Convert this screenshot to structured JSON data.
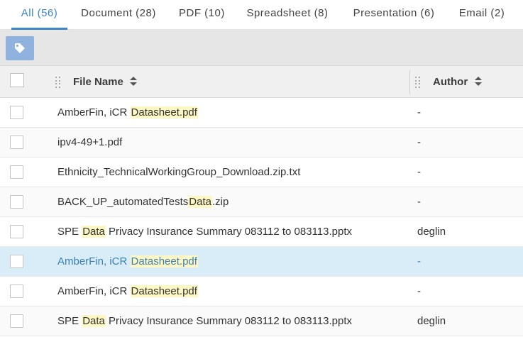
{
  "tabs": [
    {
      "label": "All (56)",
      "active": true
    },
    {
      "label": "Document (28)",
      "active": false
    },
    {
      "label": "PDF (10)",
      "active": false
    },
    {
      "label": "Spreadsheet (8)",
      "active": false
    },
    {
      "label": "Presentation (6)",
      "active": false
    },
    {
      "label": "Email (2)",
      "active": false
    }
  ],
  "toolbar": {
    "tag_button_icon": "tag-icon",
    "tag_button_color": "#8fb3de"
  },
  "table": {
    "columns": [
      {
        "label": "File Name",
        "sort_icon": "sort-icon"
      },
      {
        "label": "Author",
        "sort_icon": "sort-icon"
      }
    ],
    "highlight_term": [
      "Data"
    ],
    "rows": [
      {
        "parts": [
          {
            "t": "AmberFin, iCR "
          },
          {
            "t": "Datasheet.pdf",
            "h": true
          }
        ],
        "author": "-",
        "selected": false
      },
      {
        "parts": [
          {
            "t": "ipv4-49+1.pdf"
          }
        ],
        "author": "-",
        "selected": false
      },
      {
        "parts": [
          {
            "t": "Ethnicity_TechnicalWorkingGroup_Download.zip.txt"
          }
        ],
        "author": "-",
        "selected": false
      },
      {
        "parts": [
          {
            "t": "BACK_UP_automatedTests"
          },
          {
            "t": "Data",
            "h": true
          },
          {
            "t": ".zip"
          }
        ],
        "author": "-",
        "selected": false
      },
      {
        "parts": [
          {
            "t": "SPE "
          },
          {
            "t": "Data",
            "h": true
          },
          {
            "t": " Privacy Insurance Summary 083112 to 083113.pptx"
          }
        ],
        "author": "deglin",
        "selected": false
      },
      {
        "parts": [
          {
            "t": "AmberFin, iCR "
          },
          {
            "t": "Datasheet.pdf",
            "h": true
          }
        ],
        "author": "-",
        "selected": true
      },
      {
        "parts": [
          {
            "t": "AmberFin, iCR "
          },
          {
            "t": "Datasheet.pdf",
            "h": true
          }
        ],
        "author": "-",
        "selected": false
      },
      {
        "parts": [
          {
            "t": "SPE "
          },
          {
            "t": "Data",
            "h": true
          },
          {
            "t": " Privacy Insurance Summary 083112 to 083113.pptx"
          }
        ],
        "author": "deglin",
        "selected": false
      }
    ]
  },
  "colors": {
    "accent": "#3a86c8",
    "selected_row": "#d9edf8",
    "highlight": "#fdf7c4"
  }
}
